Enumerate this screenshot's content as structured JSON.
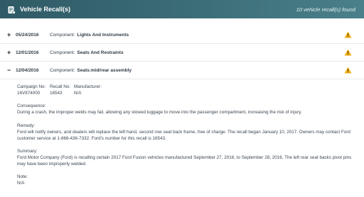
{
  "header": {
    "title": "Vehicle Recall(s)",
    "count": "10 vehicle recall(s) found"
  },
  "recalls": [
    {
      "toggle": "+",
      "date": "05/24/2016",
      "component_label": "Component:",
      "component": "Lights And Instruments"
    },
    {
      "toggle": "+",
      "date": "12/01/2016",
      "component_label": "Component:",
      "component": "Seats And Restraints"
    },
    {
      "toggle": "−",
      "date": "12/04/2016",
      "component_label": "Component:",
      "component": "Seats:mid/rear assembly"
    }
  ],
  "detail": {
    "campaign_label": "Campaign No:",
    "campaign_value": "16V874000",
    "recall_label": "Recall No:",
    "recall_value": "16543",
    "manufacturer_label": "Manufacturer:",
    "manufacturer_value": "N/A",
    "consequence_label": "Consequence:",
    "consequence_text": "During a crash, the improper welds may fail, allowing any stowed luggage to move into the passenger compartment, increasing the risk of injury.",
    "remedy_label": "Remedy:",
    "remedy_text": "Ford will notify owners, and dealers will replace the left hand, second row seat back frame, free of charge. The recall began January 10, 2017. Owners may contact Ford customer service at 1-866-436-7332. Ford's number for this recall is 16543.",
    "summary_label": "Summary:",
    "summary_text": "Ford Motor Company (Ford) is recalling certain 2017 Ford Fusion vehicles manufactured September 27, 2016, to September 28, 2016. The left rear seat backs pivot pins may have been improperly welded.",
    "note_label": "Note:",
    "note_text": "N/A"
  },
  "colors": {
    "header_start": "#2f5a66",
    "warning": "#f2b01e"
  },
  "icons": {
    "header": "document-list-icon",
    "row": "warning-icon"
  }
}
